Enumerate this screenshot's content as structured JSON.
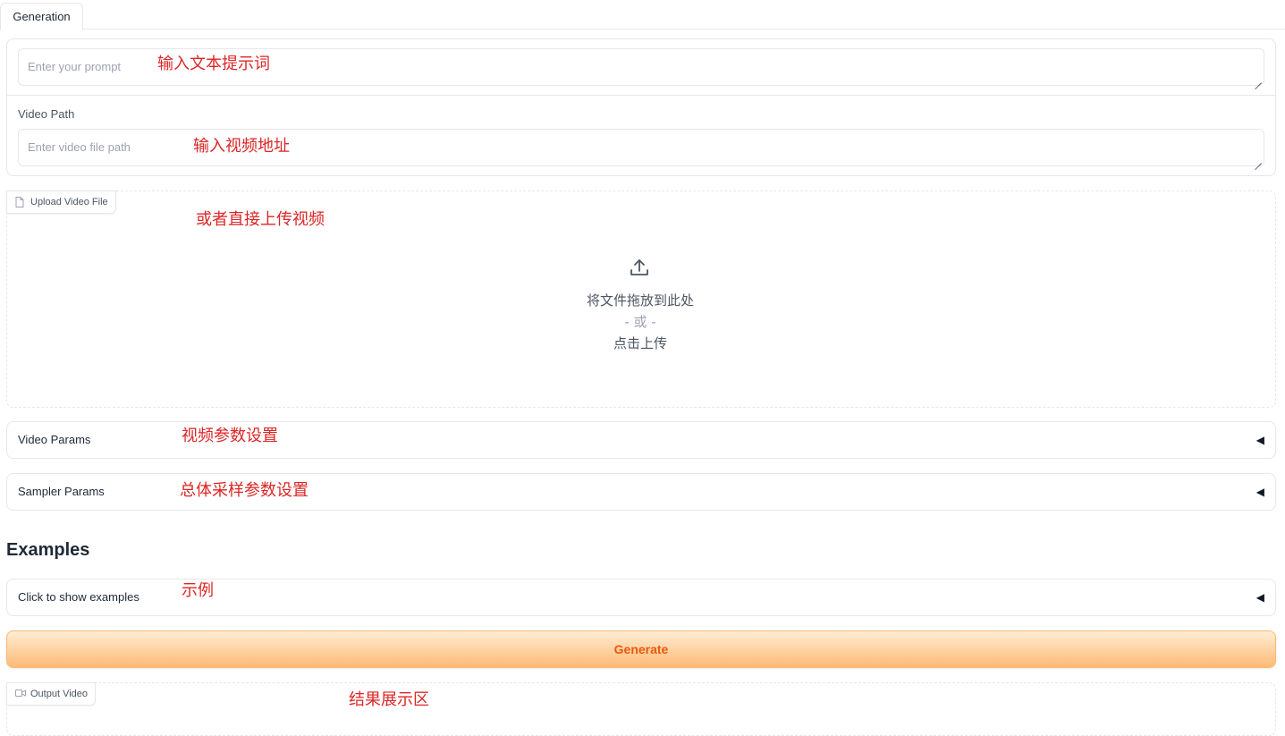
{
  "tabs": [
    {
      "label": "Generation"
    }
  ],
  "prompt": {
    "placeholder": "Enter your prompt",
    "annotation": "输入文本提示词"
  },
  "video_path": {
    "label": "Video Path",
    "placeholder": "Enter video file path",
    "annotation": "输入视频地址"
  },
  "upload": {
    "chip_label": "Upload Video File",
    "annotation": "或者直接上传视频",
    "drop_text": "将文件拖放到此处",
    "or_text": "- 或 -",
    "click_text": "点击上传",
    "icon": "upload-icon"
  },
  "video_params": {
    "label": "Video Params",
    "annotation": "视频参数设置",
    "arrow": "◀"
  },
  "sampler_params": {
    "label": "Sampler Params",
    "annotation": "总体采样参数设置",
    "arrow": "◀"
  },
  "examples": {
    "heading": "Examples",
    "label": "Click to show examples",
    "annotation": "示例",
    "arrow": "◀"
  },
  "generate": {
    "label": "Generate",
    "accent": "#ea580c"
  },
  "output": {
    "chip_label": "Output Video",
    "annotation": "结果展示区",
    "icon": "video-camera-icon"
  },
  "colors": {
    "annotation": "#dc2626",
    "border": "#e5e7eb",
    "button_gradient_start": "#ffedd5",
    "button_gradient_end": "#fdba74"
  }
}
